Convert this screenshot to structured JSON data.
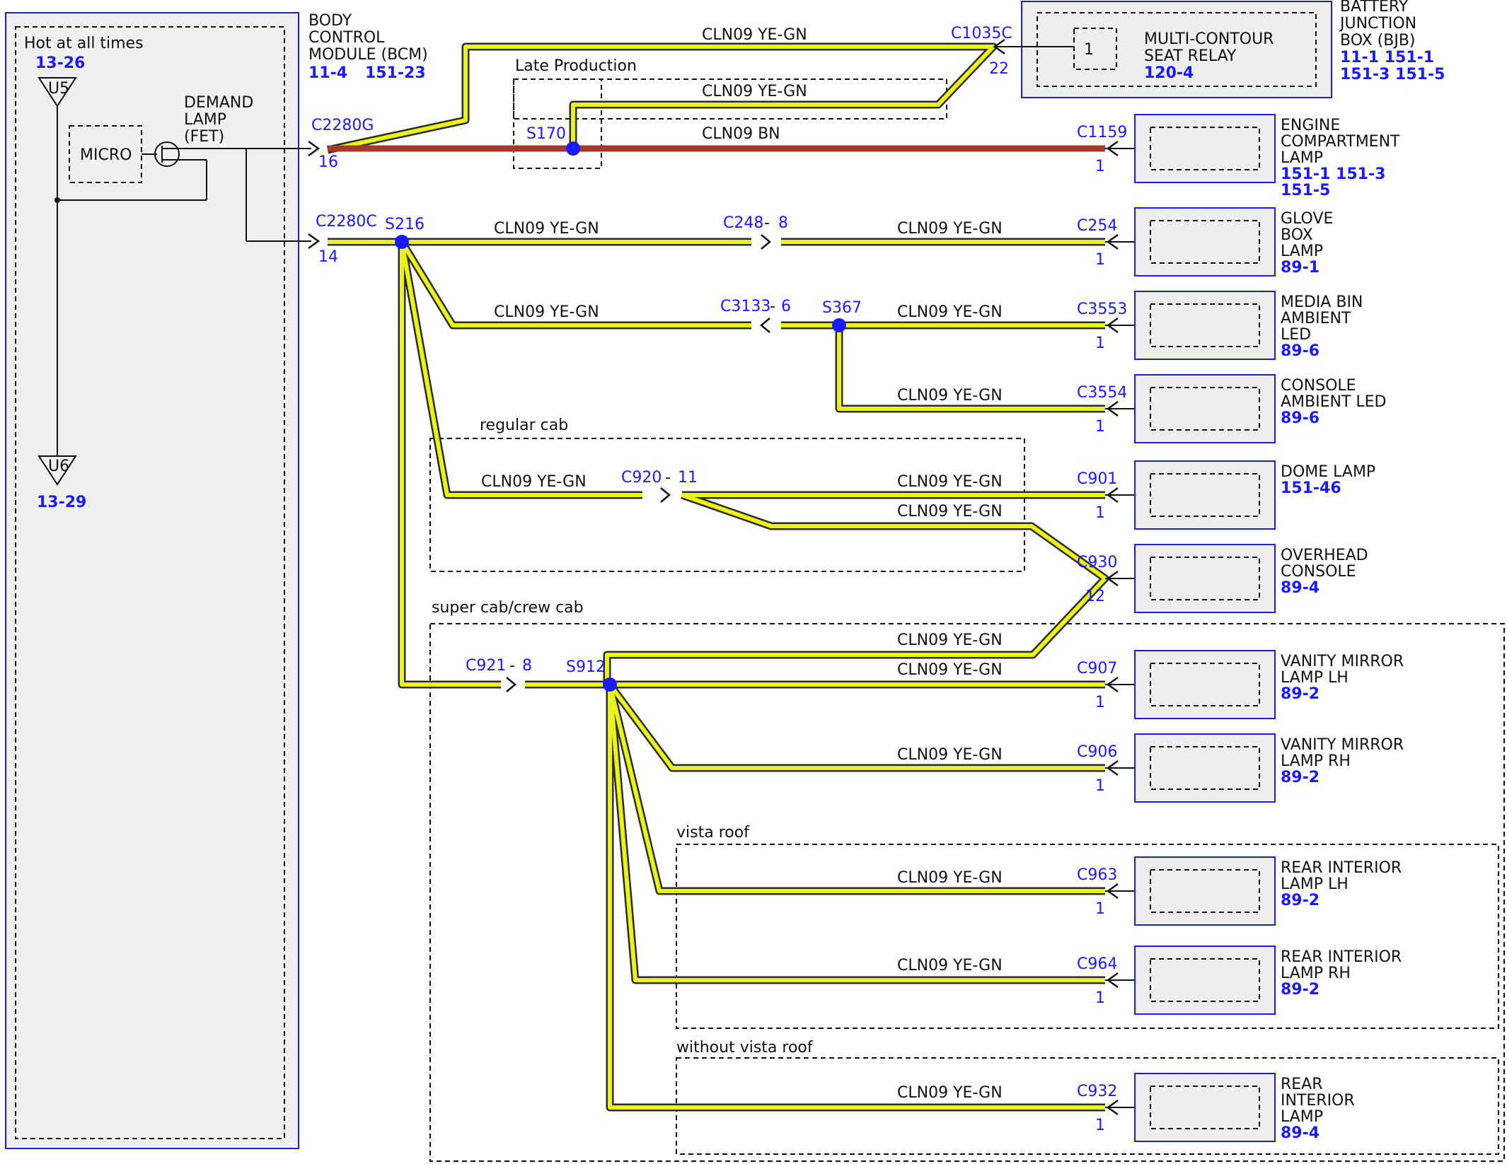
{
  "colors": {
    "wire_main": "#eaf21a",
    "wire_bn": "#a63a2a",
    "accent": "#1a1aff"
  },
  "bcm": {
    "hot_label": "Hot at all times",
    "u5_ref": "13-26",
    "u5_label": "U5",
    "u6_label": "U6",
    "u6_ref": "13-29",
    "micro_label": "MICRO",
    "demand_lamp": [
      "DEMAND",
      "LAMP",
      "(FET)"
    ],
    "title": [
      "BODY",
      "CONTROL",
      "MODULE (BCM)"
    ],
    "ref_a": "11-4",
    "ref_b": "151-23"
  },
  "bjb": {
    "title": [
      "BATTERY",
      "JUNCTION",
      "BOX (BJB)"
    ],
    "refs": [
      "11-1   151-1",
      "151-3 151-5"
    ],
    "relay_label": [
      "MULTI-CONTOUR",
      "SEAT RELAY"
    ],
    "relay_ref": "120-4",
    "relay_pin": "1"
  },
  "groups": {
    "late_production": "Late Production",
    "regular_cab": "regular cab",
    "super_crew_cab": "super cab/crew cab",
    "vista_roof": "vista roof",
    "without_vista_roof": "without vista roof"
  },
  "connectors": {
    "c2280g": "C2280G",
    "c2280g_pin": "16",
    "c2280c": "C2280C",
    "c2280c_pin": "14",
    "c1035c": "C1035C",
    "c1035c_pin": "22",
    "c248": "C248",
    "c248_pin": "8",
    "c3133": "C3133",
    "c3133_pin": "6",
    "c920": "C920",
    "c920_pin": "11",
    "c921": "C921",
    "c921_pin": "8",
    "c930": "C930",
    "c930_pin": "12"
  },
  "splices": {
    "s170": "S170",
    "s216": "S216",
    "s367": "S367",
    "s912": "S912"
  },
  "wire_labels": {
    "top_bjb": "CLN09   YE-GN",
    "late_prod": "CLN09   YE-GN",
    "brown": "CLN09   BN",
    "glove_left": "CLN09   YE-GN",
    "glove_right": "CLN09   YE-GN",
    "media_left": "CLN09   YE-GN",
    "media_right": "CLN09   YE-GN",
    "console": "CLN09   YE-GN",
    "regular_left": "CLN09   YE-GN",
    "dome": "CLN09   YE-GN",
    "overhead_regular": "CLN09   YE-GN",
    "overhead_super": "CLN09   YE-GN",
    "vanity_lh": "CLN09   YE-GN",
    "vanity_rh": "CLN09   YE-GN",
    "rear_lh": "CLN09   YE-GN",
    "rear_rh": "CLN09   YE-GN",
    "rear_int": "CLN09   YE-GN"
  },
  "devices": [
    {
      "id": "engine",
      "conn": "C1159",
      "pin": "1",
      "name": [
        "ENGINE",
        "COMPARTMENT",
        "LAMP"
      ],
      "refs": [
        "151-1 151-3",
        "151-5"
      ]
    },
    {
      "id": "glove",
      "conn": "C254",
      "pin": "1",
      "name": [
        "GLOVE",
        "BOX",
        "LAMP"
      ],
      "refs": [
        "89-1"
      ]
    },
    {
      "id": "media",
      "conn": "C3553",
      "pin": "1",
      "name": [
        "MEDIA BIN",
        "AMBIENT",
        "LED"
      ],
      "refs": [
        "89-6"
      ]
    },
    {
      "id": "console",
      "conn": "C3554",
      "pin": "1",
      "name": [
        "CONSOLE",
        "AMBIENT LED"
      ],
      "refs": [
        "89-6"
      ]
    },
    {
      "id": "dome",
      "conn": "C901",
      "pin": "1",
      "name": [
        "DOME LAMP"
      ],
      "refs": [
        "151-46"
      ]
    },
    {
      "id": "overhead",
      "conn": "C930",
      "pin": "12",
      "name": [
        "OVERHEAD",
        "CONSOLE"
      ],
      "refs": [
        "89-4"
      ]
    },
    {
      "id": "vanity-lh",
      "conn": "C907",
      "pin": "1",
      "name": [
        "VANITY MIRROR",
        "LAMP LH"
      ],
      "refs": [
        "89-2"
      ]
    },
    {
      "id": "vanity-rh",
      "conn": "C906",
      "pin": "1",
      "name": [
        "VANITY MIRROR",
        "LAMP RH"
      ],
      "refs": [
        "89-2"
      ]
    },
    {
      "id": "rear-lh",
      "conn": "C963",
      "pin": "1",
      "name": [
        "REAR INTERIOR",
        "LAMP LH"
      ],
      "refs": [
        "89-2"
      ]
    },
    {
      "id": "rear-rh",
      "conn": "C964",
      "pin": "1",
      "name": [
        "REAR INTERIOR",
        "LAMP RH"
      ],
      "refs": [
        "89-2"
      ]
    },
    {
      "id": "rear-int",
      "conn": "C932",
      "pin": "1",
      "name": [
        "REAR",
        "INTERIOR",
        "LAMP"
      ],
      "refs": [
        "89-4"
      ]
    }
  ]
}
